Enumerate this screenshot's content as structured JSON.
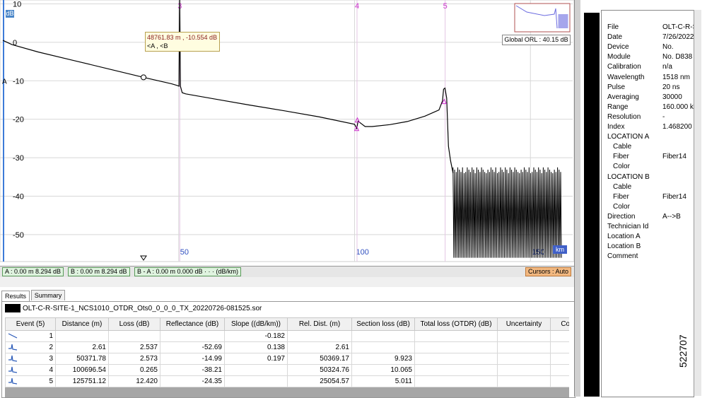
{
  "chart_data": {
    "type": "line",
    "xunit": "km",
    "yunit": "dB",
    "xlim": [
      0,
      160
    ],
    "ylim": [
      -57,
      11
    ],
    "xticks": [
      50,
      100,
      150
    ],
    "yticks": [
      10,
      0,
      -10,
      -20,
      -30,
      -40,
      -50
    ],
    "series": [
      {
        "points": [
          [
            0,
            0.5
          ],
          [
            2.6,
            -0.6
          ],
          [
            10,
            -2.5
          ],
          [
            20,
            -4.7
          ],
          [
            30,
            -6.9
          ],
          [
            40,
            -9.1
          ],
          [
            48,
            -10.8
          ],
          [
            49.5,
            -11.2
          ],
          [
            50.1,
            -11.4
          ],
          [
            50.3,
            12
          ],
          [
            50.5,
            -11.4
          ],
          [
            51,
            -13.1
          ],
          [
            52,
            -13.4
          ],
          [
            60,
            -14.7
          ],
          [
            70,
            -16.3
          ],
          [
            80,
            -17.8
          ],
          [
            90,
            -19.4
          ],
          [
            100,
            -21.3
          ],
          [
            100.6,
            -22.4
          ],
          [
            101,
            -20.5
          ],
          [
            102,
            -21.2
          ],
          [
            103,
            -21.9
          ],
          [
            105,
            -21.9
          ],
          [
            110,
            -21.4
          ],
          [
            115,
            -20.6
          ],
          [
            120,
            -19.2
          ],
          [
            124,
            -17.6
          ],
          [
            125,
            -15.2
          ],
          [
            125.3,
            -12.2
          ],
          [
            125.7,
            -11.9
          ],
          [
            126.2,
            -14.5
          ],
          [
            126.7,
            -27
          ],
          [
            127.3,
            -30.8
          ],
          [
            128,
            -34
          ]
        ],
        "noise_start_km": 128,
        "noise_end_km": 159,
        "noise_high_db": -32.5,
        "noise_low_db": -56
      }
    ],
    "event_markers": [
      {
        "label": "3",
        "x": 50.3
      },
      {
        "label": "4",
        "x": 100.7
      },
      {
        "label": "5",
        "x": 125.75
      }
    ],
    "y_axis_badge": "dB",
    "x_axis_badge": "km",
    "cursor_a_label": "A",
    "global_orl": "Global ORL : 40.15 dB",
    "tooltip": {
      "line1": "48761.83 m , -10.554 dB",
      "line2": "<A , <B"
    }
  },
  "cursor_bar": {
    "a": "A : 0.00 m   8.294 dB",
    "b": "B : 0.00 m   8.294 dB",
    "ba": "B - A : 0.00 m   0.000 dB · · · (dB/km)",
    "auto": "Cursors : Auto"
  },
  "tabs": [
    {
      "label": "Results"
    },
    {
      "label": "Summary"
    }
  ],
  "file_name": "OLT-C-R-SITE-1_NCS1010_OTDR_Ots0_0_0_0_TX_20220726-081525.sor",
  "table": {
    "headers": [
      "Event (5)",
      "Distance (m)",
      "Loss (dB)",
      "Reflectance (dB)",
      "Slope ((dB/km))",
      "Rel. Dist. (m)",
      "Section loss (dB)",
      "Total loss (OTDR) (dB)",
      "Uncertainty",
      "Comment"
    ],
    "rows": [
      {
        "icon": "fiber-section-icon",
        "cells": [
          "1",
          "",
          "",
          "",
          "-0.182",
          "",
          "",
          "",
          "",
          ""
        ]
      },
      {
        "icon": "reflective-event-icon",
        "cells": [
          "2",
          "2.61",
          "2.537",
          "-52.69",
          "0.138",
          "2.61",
          "",
          "",
          "",
          ""
        ]
      },
      {
        "icon": "reflective-event-icon",
        "cells": [
          "3",
          "50371.78",
          "2.573",
          "-14.99",
          "0.197",
          "50369.17",
          "9.923",
          "",
          "",
          ""
        ]
      },
      {
        "icon": "reflective-event-icon",
        "cells": [
          "4",
          "100696.54",
          "0.265",
          "-38.21",
          "",
          "50324.76",
          "10.065",
          "",
          "",
          ""
        ]
      },
      {
        "icon": "reflective-event-icon",
        "cells": [
          "5",
          "125751.12",
          "12.420",
          "-24.35",
          "",
          "25054.57",
          "5.011",
          "",
          "",
          ""
        ]
      }
    ]
  },
  "info": [
    {
      "label": "File",
      "value": "OLT-C-R-S",
      "indent": false
    },
    {
      "label": "Date",
      "value": "7/26/2022",
      "indent": false
    },
    {
      "label": "Device",
      "value": "No.",
      "indent": false
    },
    {
      "label": "Module",
      "value": "No. D838",
      "indent": false
    },
    {
      "label": "Calibration",
      "value": "n/a",
      "indent": false
    },
    {
      "label": "Wavelength",
      "value": "1518 nm",
      "indent": false
    },
    {
      "label": "Pulse",
      "value": "20 ns",
      "indent": false
    },
    {
      "label": "Averaging",
      "value": "30000",
      "indent": false
    },
    {
      "label": "Range",
      "value": "160.000 k",
      "indent": false
    },
    {
      "label": "Resolution",
      "value": "-",
      "indent": false
    },
    {
      "label": "Index",
      "value": "1.468200",
      "indent": false
    },
    {
      "label": "LOCATION A",
      "value": "",
      "indent": false
    },
    {
      "label": "Cable",
      "value": "",
      "indent": true
    },
    {
      "label": "Fiber",
      "value": "Fiber14",
      "indent": true
    },
    {
      "label": "Color",
      "value": "",
      "indent": true
    },
    {
      "label": "LOCATION B",
      "value": "",
      "indent": false
    },
    {
      "label": "Cable",
      "value": "",
      "indent": true
    },
    {
      "label": "Fiber",
      "value": "Fiber14",
      "indent": true
    },
    {
      "label": "Color",
      "value": "",
      "indent": true
    },
    {
      "label": "Direction",
      "value": "A-->B",
      "indent": false
    },
    {
      "label": "Technician Id",
      "value": "",
      "indent": false
    },
    {
      "label": "Location A",
      "value": "",
      "indent": false
    },
    {
      "label": "Location B",
      "value": "",
      "indent": false
    },
    {
      "label": "Comment",
      "value": "",
      "indent": false
    }
  ],
  "figure_number": "522707",
  "colors": {
    "trace": "#000000",
    "event_marker": "#cc33cc",
    "grid": "#d8d8d8",
    "overview_trace": "#6a6ae0"
  }
}
